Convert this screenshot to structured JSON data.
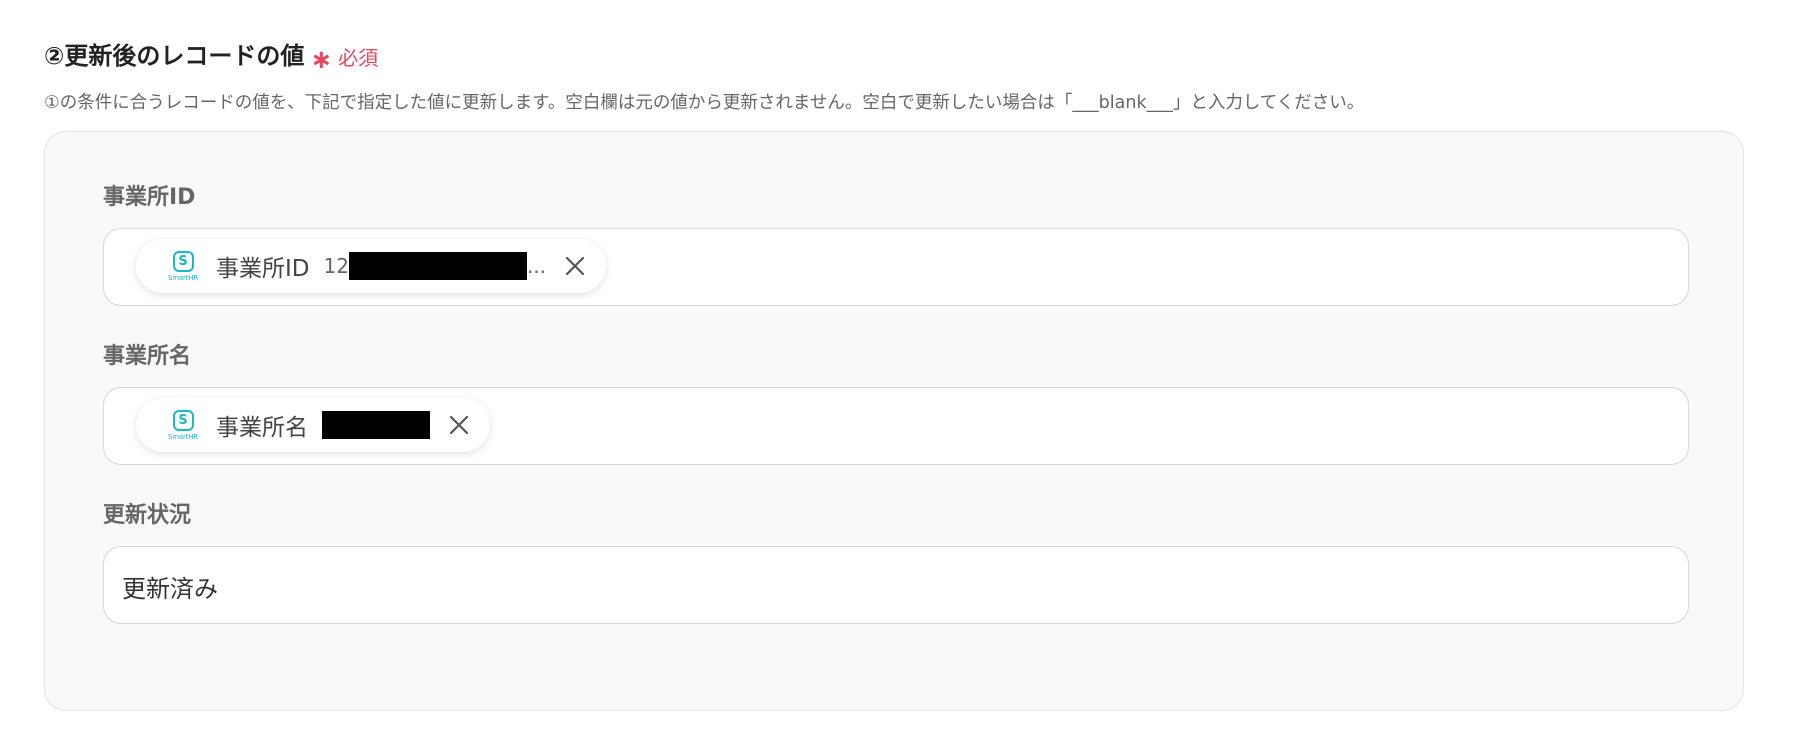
{
  "section": {
    "title": "②更新後のレコードの値",
    "required_mark": "∗",
    "required_label": "必須",
    "description": "①の条件に合うレコードの値を、下記で指定した値に更新します。空白欄は元の値から更新されません。空白で更新したい場合は「___blank___」と入力してください。"
  },
  "fields": [
    {
      "label": "事業所ID",
      "chip": {
        "app_logo_text": "SmartHR",
        "app_logo_letter": "S",
        "label": "事業所ID",
        "value_prefix": "12",
        "value_suffix": "...",
        "icon": "close-icon"
      }
    },
    {
      "label": "事業所名",
      "chip": {
        "app_logo_text": "SmartHR",
        "app_logo_letter": "S",
        "label": "事業所名",
        "icon": "close-icon"
      }
    },
    {
      "label": "更新状況",
      "value": "更新済み"
    }
  ],
  "colors": {
    "accent_required": "#e8475f",
    "smarthr_brand": "#1bb9c4",
    "panel_background": "#f9f9f9"
  }
}
